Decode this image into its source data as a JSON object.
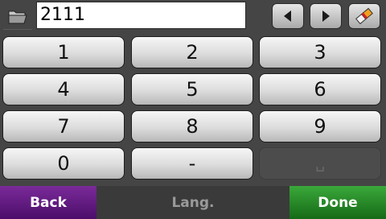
{
  "input": {
    "value": "2111"
  },
  "keys": {
    "k1": "1",
    "k2": "2",
    "k3": "3",
    "k4": "4",
    "k5": "5",
    "k6": "6",
    "k7": "7",
    "k8": "8",
    "k9": "9",
    "k0": "0",
    "dash": "-",
    "space": "␣"
  },
  "footer": {
    "back": "Back",
    "lang": "Lang.",
    "done": "Done"
  },
  "icons": {
    "folder": "folder-icon",
    "left": "arrow-left-icon",
    "right": "arrow-right-icon",
    "erase": "eraser-icon"
  },
  "colors": {
    "back": "#5e1a80",
    "done": "#1f8a1f",
    "background": "#454545"
  }
}
